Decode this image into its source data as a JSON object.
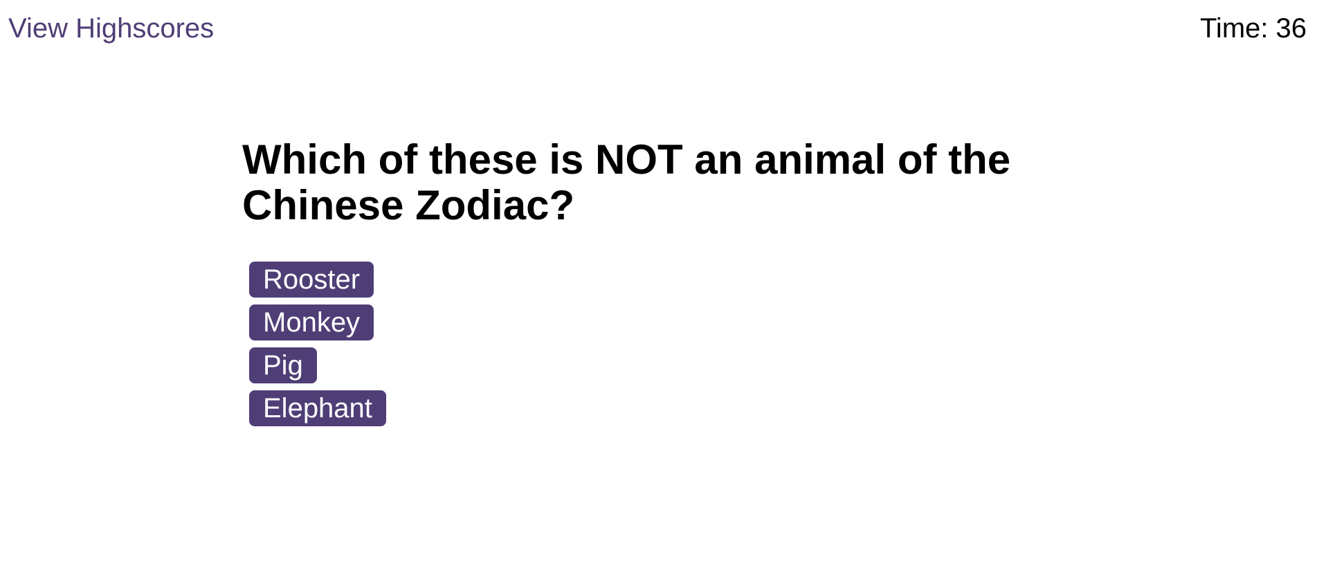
{
  "header": {
    "highscores_label": "View Highscores",
    "timer_label": "Time:",
    "timer_value": "36"
  },
  "quiz": {
    "question": "Which of these is NOT an animal of the Chinese Zodiac?",
    "choices": [
      {
        "label": "Rooster"
      },
      {
        "label": "Monkey"
      },
      {
        "label": "Pig"
      },
      {
        "label": "Elephant"
      }
    ]
  },
  "colors": {
    "accent": "#4f3e76",
    "button_text": "#ffffff",
    "text": "#000000",
    "background": "#ffffff"
  }
}
